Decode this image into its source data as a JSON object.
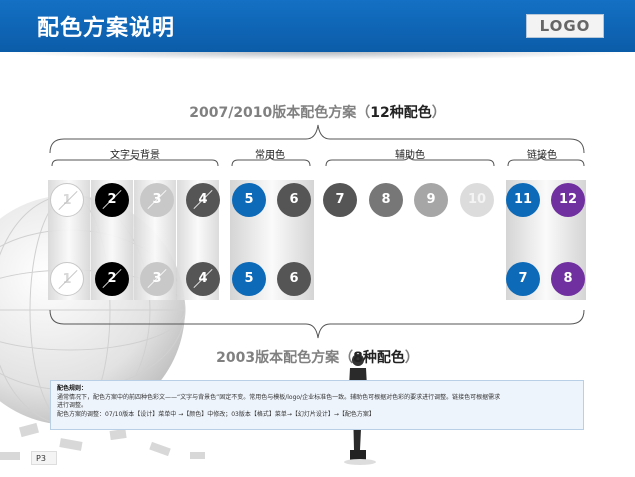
{
  "header": {
    "title": "配色方案说明",
    "logo": "LOGO",
    "bg_color": "#0b5ca8"
  },
  "scheme2007": {
    "heading_prefix": "2007/2010版本配色方案（",
    "heading_emph": "12种配色",
    "heading_suffix": "）",
    "groups": [
      {
        "label": "文字与背景"
      },
      {
        "label": "常用色"
      },
      {
        "label": "辅助色"
      },
      {
        "label": "链接色"
      }
    ],
    "colors": [
      {
        "n": "1",
        "hex": "#ffffff"
      },
      {
        "n": "2",
        "hex": "#000000"
      },
      {
        "n": "3",
        "hex": "#c8c8c8"
      },
      {
        "n": "4",
        "hex": "#555555"
      },
      {
        "n": "5",
        "hex": "#0d6ab8"
      },
      {
        "n": "6",
        "hex": "#555555"
      },
      {
        "n": "7",
        "hex": "#555555"
      },
      {
        "n": "8",
        "hex": "#777777"
      },
      {
        "n": "9",
        "hex": "#a6a6a6"
      },
      {
        "n": "10",
        "hex": "#dcdcdc"
      },
      {
        "n": "11",
        "hex": "#0d6ab8"
      },
      {
        "n": "12",
        "hex": "#7030a0"
      }
    ]
  },
  "scheme2003": {
    "heading_prefix": "2003版本配色方案（",
    "heading_emph": "8种配色",
    "heading_suffix": "）",
    "colors": [
      {
        "n": "1"
      },
      {
        "n": "2"
      },
      {
        "n": "3"
      },
      {
        "n": "4"
      },
      {
        "n": "5"
      },
      {
        "n": "6"
      },
      {
        "n": "7"
      },
      {
        "n": "8"
      }
    ]
  },
  "rules": {
    "title": "配色规则：",
    "line1": "通常情况下，配色方案中的前四种色彩文——“文字与背景色”固定不变。常用色与模板/logo/企业标准色一致。辅助色可根据对色彩的要求进行调整。链接色可根据需求",
    "line2": "进行调整。",
    "line3": "配色方案的调整：07/10版本【设计】菜单中 →【颜色】中修改；03版本【格式】菜单→【幻灯片设计】→【配色方案】"
  },
  "page_number": "P3"
}
